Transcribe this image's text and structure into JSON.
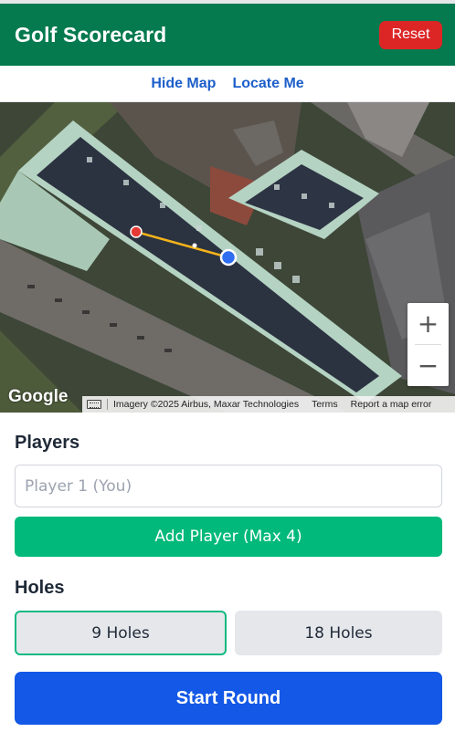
{
  "header": {
    "title": "Golf Scorecard",
    "reset_label": "Reset"
  },
  "map_links": {
    "hide_map": "Hide Map",
    "locate_me": "Locate Me"
  },
  "map": {
    "google_logo": "Google",
    "imagery": "Imagery ©2025 Airbus, Maxar Technologies",
    "terms": "Terms",
    "report": "Report a map error",
    "zoom_in": "+",
    "zoom_out": "−"
  },
  "players": {
    "title": "Players",
    "input_placeholder": "Player 1 (You)",
    "add_label": "Add Player (Max 4)"
  },
  "holes": {
    "title": "Holes",
    "options": [
      "9 Holes",
      "18 Holes"
    ],
    "selected": "9 Holes"
  },
  "start_label": "Start Round",
  "colors": {
    "header_green": "#047a4e",
    "reset_red": "#dc2626",
    "add_green": "#00b97a",
    "start_blue": "#1358e6",
    "link_blue": "#1d5fc9"
  }
}
